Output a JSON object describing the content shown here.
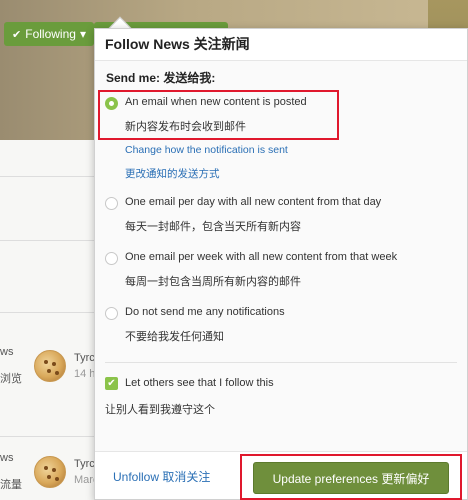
{
  "background": {
    "following_label": "Following",
    "row1": {
      "side_line1": "ws",
      "side_line2": "浏览",
      "name": "Tyrc",
      "sub": "14 h"
    },
    "row2": {
      "side_line1": "ws",
      "side_line2": "流量",
      "name": "Tyrc",
      "sub": "Marc"
    }
  },
  "popup": {
    "title": "Follow News  关注新闻",
    "send_me": "Send me:  发送给我:",
    "options": [
      {
        "label": "An email when new content is posted",
        "label_zh": "新内容发布时会收到邮件",
        "selected": true
      },
      {
        "label": "One email per day with all new content from that day",
        "label_zh": "每天一封邮件，包含当天所有新内容",
        "selected": false
      },
      {
        "label": "One email per week with all new content from that week",
        "label_zh": "每周一封包含当周所有新内容的邮件",
        "selected": false
      },
      {
        "label": "Do not send me any notifications",
        "label_zh": "不要给我发任何通知",
        "selected": false
      }
    ],
    "change_link": "Change how the notification is sent",
    "change_link_zh": "更改通知的发送方式",
    "let_others_label": "Let others see that I follow this",
    "let_others_zh": "让别人看到我遵守这个",
    "let_others_checked": true,
    "unfollow_label": "Unfollow  取消关注",
    "update_label": "Update preferences  更新偏好"
  },
  "colors": {
    "accent_green": "#8bc34a",
    "button_green": "#6f8f3c",
    "link_blue": "#2a6fb5",
    "highlight_red": "#e0182d"
  }
}
